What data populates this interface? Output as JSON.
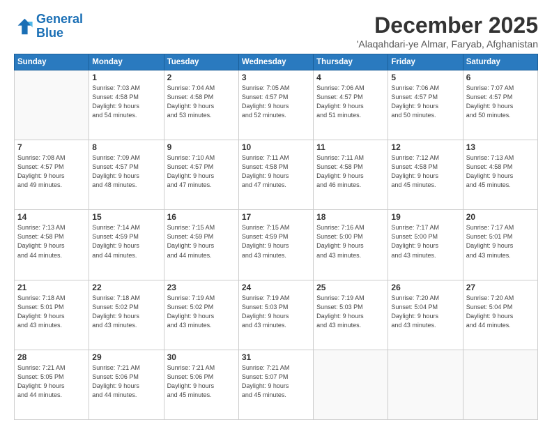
{
  "logo": {
    "line1": "General",
    "line2": "Blue"
  },
  "title": "December 2025",
  "location": "'Alaqahdari-ye Almar, Faryab, Afghanistan",
  "days_of_week": [
    "Sunday",
    "Monday",
    "Tuesday",
    "Wednesday",
    "Thursday",
    "Friday",
    "Saturday"
  ],
  "weeks": [
    [
      {
        "day": "",
        "info": ""
      },
      {
        "day": "1",
        "info": "Sunrise: 7:03 AM\nSunset: 4:58 PM\nDaylight: 9 hours\nand 54 minutes."
      },
      {
        "day": "2",
        "info": "Sunrise: 7:04 AM\nSunset: 4:58 PM\nDaylight: 9 hours\nand 53 minutes."
      },
      {
        "day": "3",
        "info": "Sunrise: 7:05 AM\nSunset: 4:57 PM\nDaylight: 9 hours\nand 52 minutes."
      },
      {
        "day": "4",
        "info": "Sunrise: 7:06 AM\nSunset: 4:57 PM\nDaylight: 9 hours\nand 51 minutes."
      },
      {
        "day": "5",
        "info": "Sunrise: 7:06 AM\nSunset: 4:57 PM\nDaylight: 9 hours\nand 50 minutes."
      },
      {
        "day": "6",
        "info": "Sunrise: 7:07 AM\nSunset: 4:57 PM\nDaylight: 9 hours\nand 50 minutes."
      }
    ],
    [
      {
        "day": "7",
        "info": "Sunrise: 7:08 AM\nSunset: 4:57 PM\nDaylight: 9 hours\nand 49 minutes."
      },
      {
        "day": "8",
        "info": "Sunrise: 7:09 AM\nSunset: 4:57 PM\nDaylight: 9 hours\nand 48 minutes."
      },
      {
        "day": "9",
        "info": "Sunrise: 7:10 AM\nSunset: 4:57 PM\nDaylight: 9 hours\nand 47 minutes."
      },
      {
        "day": "10",
        "info": "Sunrise: 7:11 AM\nSunset: 4:58 PM\nDaylight: 9 hours\nand 47 minutes."
      },
      {
        "day": "11",
        "info": "Sunrise: 7:11 AM\nSunset: 4:58 PM\nDaylight: 9 hours\nand 46 minutes."
      },
      {
        "day": "12",
        "info": "Sunrise: 7:12 AM\nSunset: 4:58 PM\nDaylight: 9 hours\nand 45 minutes."
      },
      {
        "day": "13",
        "info": "Sunrise: 7:13 AM\nSunset: 4:58 PM\nDaylight: 9 hours\nand 45 minutes."
      }
    ],
    [
      {
        "day": "14",
        "info": "Sunrise: 7:13 AM\nSunset: 4:58 PM\nDaylight: 9 hours\nand 44 minutes."
      },
      {
        "day": "15",
        "info": "Sunrise: 7:14 AM\nSunset: 4:59 PM\nDaylight: 9 hours\nand 44 minutes."
      },
      {
        "day": "16",
        "info": "Sunrise: 7:15 AM\nSunset: 4:59 PM\nDaylight: 9 hours\nand 44 minutes."
      },
      {
        "day": "17",
        "info": "Sunrise: 7:15 AM\nSunset: 4:59 PM\nDaylight: 9 hours\nand 43 minutes."
      },
      {
        "day": "18",
        "info": "Sunrise: 7:16 AM\nSunset: 5:00 PM\nDaylight: 9 hours\nand 43 minutes."
      },
      {
        "day": "19",
        "info": "Sunrise: 7:17 AM\nSunset: 5:00 PM\nDaylight: 9 hours\nand 43 minutes."
      },
      {
        "day": "20",
        "info": "Sunrise: 7:17 AM\nSunset: 5:01 PM\nDaylight: 9 hours\nand 43 minutes."
      }
    ],
    [
      {
        "day": "21",
        "info": "Sunrise: 7:18 AM\nSunset: 5:01 PM\nDaylight: 9 hours\nand 43 minutes."
      },
      {
        "day": "22",
        "info": "Sunrise: 7:18 AM\nSunset: 5:02 PM\nDaylight: 9 hours\nand 43 minutes."
      },
      {
        "day": "23",
        "info": "Sunrise: 7:19 AM\nSunset: 5:02 PM\nDaylight: 9 hours\nand 43 minutes."
      },
      {
        "day": "24",
        "info": "Sunrise: 7:19 AM\nSunset: 5:03 PM\nDaylight: 9 hours\nand 43 minutes."
      },
      {
        "day": "25",
        "info": "Sunrise: 7:19 AM\nSunset: 5:03 PM\nDaylight: 9 hours\nand 43 minutes."
      },
      {
        "day": "26",
        "info": "Sunrise: 7:20 AM\nSunset: 5:04 PM\nDaylight: 9 hours\nand 43 minutes."
      },
      {
        "day": "27",
        "info": "Sunrise: 7:20 AM\nSunset: 5:04 PM\nDaylight: 9 hours\nand 44 minutes."
      }
    ],
    [
      {
        "day": "28",
        "info": "Sunrise: 7:21 AM\nSunset: 5:05 PM\nDaylight: 9 hours\nand 44 minutes."
      },
      {
        "day": "29",
        "info": "Sunrise: 7:21 AM\nSunset: 5:06 PM\nDaylight: 9 hours\nand 44 minutes."
      },
      {
        "day": "30",
        "info": "Sunrise: 7:21 AM\nSunset: 5:06 PM\nDaylight: 9 hours\nand 45 minutes."
      },
      {
        "day": "31",
        "info": "Sunrise: 7:21 AM\nSunset: 5:07 PM\nDaylight: 9 hours\nand 45 minutes."
      },
      {
        "day": "",
        "info": ""
      },
      {
        "day": "",
        "info": ""
      },
      {
        "day": "",
        "info": ""
      }
    ]
  ]
}
